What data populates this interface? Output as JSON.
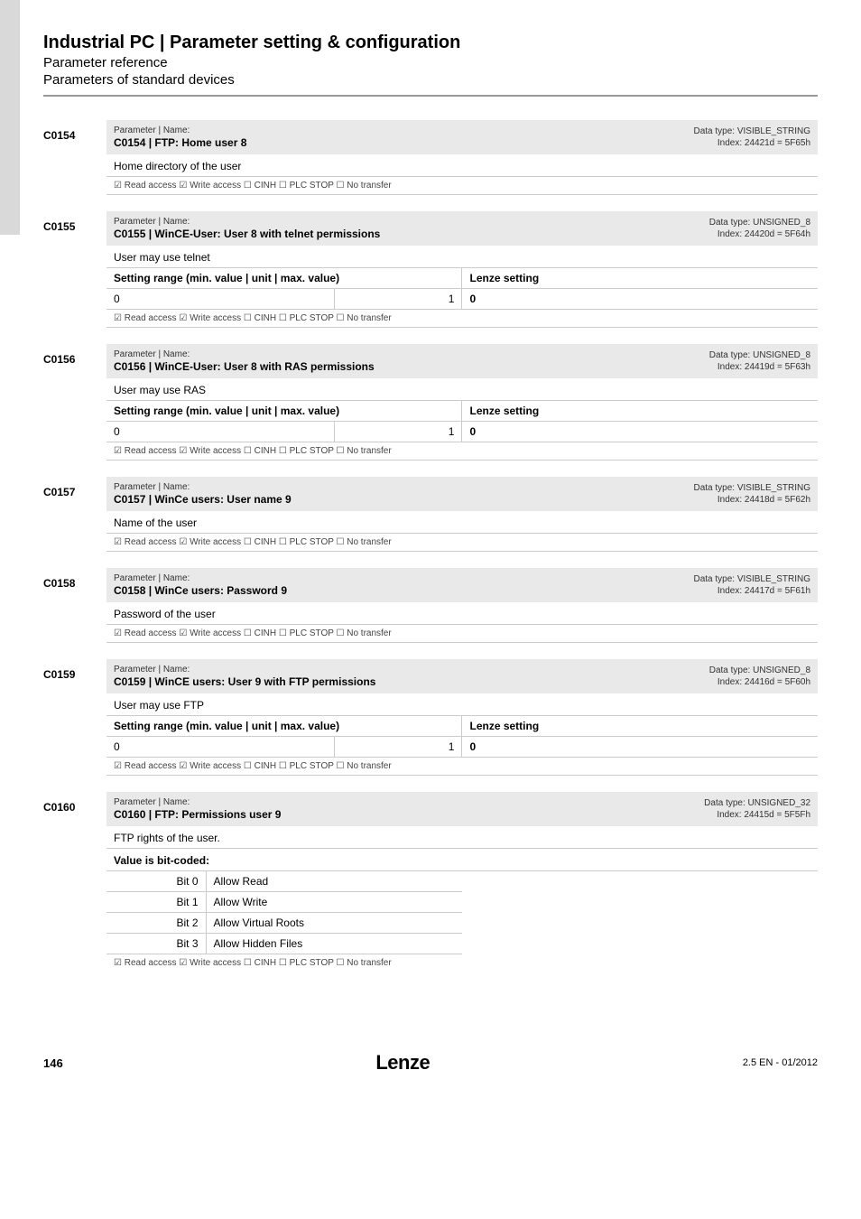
{
  "header": {
    "title": "Industrial PC | Parameter setting & configuration",
    "sub1": "Parameter reference",
    "sub2": "Parameters of standard devices"
  },
  "flags_line": "☑ Read access   ☑ Write access   ☐ CINH   ☐ PLC STOP   ☐ No transfer",
  "setting_header": {
    "range": "Setting range (min. value | unit | max. value)",
    "lenze": "Lenze setting"
  },
  "params": [
    {
      "code": "C0154",
      "pn_label": "Parameter | Name:",
      "name": "C0154 | FTP: Home user 8",
      "type": "Data type: VISIBLE_STRING",
      "index": "Index: 24421d = 5F65h",
      "desc": "Home directory of the user",
      "has_table": false
    },
    {
      "code": "C0155",
      "pn_label": "Parameter | Name:",
      "name": "C0155 | WinCE-User: User 8 with telnet permissions",
      "type": "Data type: UNSIGNED_8",
      "index": "Index: 24420d = 5F64h",
      "desc": "User may use telnet",
      "has_table": true,
      "row": {
        "min": "0",
        "max": "1",
        "val": "0"
      }
    },
    {
      "code": "C0156",
      "pn_label": "Parameter | Name:",
      "name": "C0156 | WinCE-User: User 8 with RAS permissions",
      "type": "Data type: UNSIGNED_8",
      "index": "Index: 24419d = 5F63h",
      "desc": "User may use RAS",
      "has_table": true,
      "row": {
        "min": "0",
        "max": "1",
        "val": "0"
      }
    },
    {
      "code": "C0157",
      "pn_label": "Parameter | Name:",
      "name": "C0157 | WinCe users: User name 9",
      "type": "Data type: VISIBLE_STRING",
      "index": "Index: 24418d = 5F62h",
      "desc": "Name of the user",
      "has_table": false
    },
    {
      "code": "C0158",
      "pn_label": "Parameter | Name:",
      "name": "C0158 | WinCe users: Password 9",
      "type": "Data type: VISIBLE_STRING",
      "index": "Index: 24417d = 5F61h",
      "desc": "Password of the user",
      "has_table": false
    },
    {
      "code": "C0159",
      "pn_label": "Parameter | Name:",
      "name": "C0159 | WinCE users: User 9 with FTP permissions",
      "type": "Data type: UNSIGNED_8",
      "index": "Index: 24416d = 5F60h",
      "desc": "User may use FTP",
      "has_table": true,
      "row": {
        "min": "0",
        "max": "1",
        "val": "0"
      }
    }
  ],
  "param_bits": {
    "code": "C0160",
    "pn_label": "Parameter | Name:",
    "name": "C0160 | FTP: Permissions user 9",
    "type": "Data type: UNSIGNED_32",
    "index": "Index: 24415d = 5F5Fh",
    "desc": "FTP rights of the user.",
    "bits_title": "Value is bit-coded:",
    "bits": [
      {
        "bit": "Bit 0",
        "label": "Allow Read"
      },
      {
        "bit": "Bit 1",
        "label": "Allow Write"
      },
      {
        "bit": "Bit 2",
        "label": "Allow Virtual Roots"
      },
      {
        "bit": "Bit 3",
        "label": "Allow Hidden Files"
      }
    ]
  },
  "footer": {
    "page": "146",
    "logo": "Lenze",
    "rev": "2.5 EN - 01/2012"
  }
}
